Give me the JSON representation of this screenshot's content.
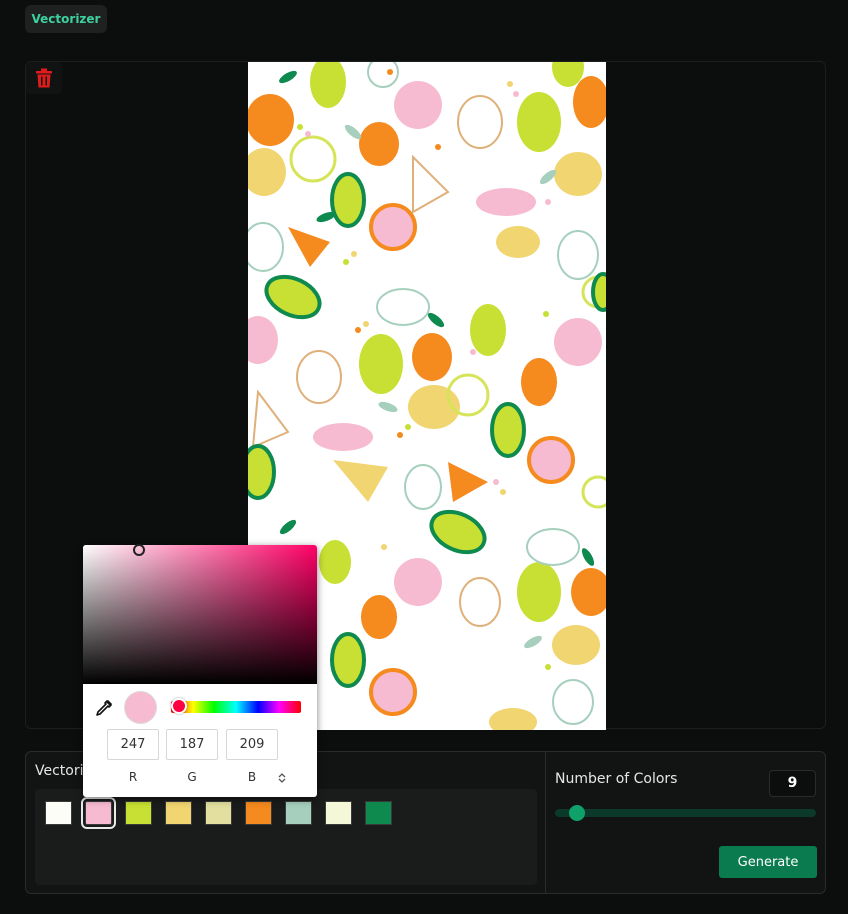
{
  "header": {
    "tab_label": "Vectorizer"
  },
  "icons": {
    "trash": "trash-icon",
    "eyedropper": "eyedropper-icon"
  },
  "vectorize": {
    "label": "Vectoriz"
  },
  "palette": {
    "swatches": [
      {
        "color": "#fcfdf7",
        "selected": false
      },
      {
        "color": "#f7bbd1",
        "selected": true
      },
      {
        "color": "#c7e033",
        "selected": false
      },
      {
        "color": "#f0d570",
        "selected": false
      },
      {
        "color": "#e2df9f",
        "selected": false
      },
      {
        "color": "#f58a1e",
        "selected": false
      },
      {
        "color": "#a6cfbd",
        "selected": false
      },
      {
        "color": "#f4f8d8",
        "selected": false
      },
      {
        "color": "#0f8a4f",
        "selected": false
      }
    ]
  },
  "controls": {
    "num_colors_label": "Number of Colors",
    "num_colors_value": "9",
    "slider_fraction": 0.09,
    "generate_label": "Generate"
  },
  "color_picker": {
    "current_color": "#f7bbd1",
    "r": "247",
    "g": "187",
    "b": "209",
    "r_label": "R",
    "g_label": "G",
    "b_label": "B",
    "toggle_symbol": "⌃⌄"
  },
  "colors": {
    "background": "#0c0d0d",
    "accent": "#0a7a4f",
    "tab_text": "#3fd0a0",
    "trash": "#e01b1b"
  }
}
